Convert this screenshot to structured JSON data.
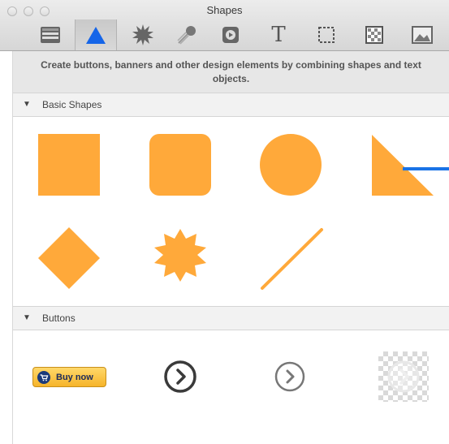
{
  "window": {
    "title": "Shapes"
  },
  "toolbar": {
    "buttons": [
      {
        "icon": "window-icon",
        "selected": false
      },
      {
        "icon": "triangle-shape-icon",
        "selected": true
      },
      {
        "icon": "starburst-icon",
        "selected": false
      },
      {
        "icon": "brush-icon",
        "selected": false
      },
      {
        "icon": "play-media-icon",
        "selected": false
      },
      {
        "icon": "text-icon",
        "selected": false
      },
      {
        "icon": "selection-rect-icon",
        "selected": false
      },
      {
        "icon": "checker-pattern-icon",
        "selected": false
      },
      {
        "icon": "picture-icon",
        "selected": false
      }
    ],
    "text_glyph": "T"
  },
  "description": "Create buttons, banners and other design elements by combining shapes and text objects.",
  "sections": {
    "basic": {
      "label": "Basic Shapes"
    },
    "buttons": {
      "label": "Buttons"
    }
  },
  "buttons_items": {
    "buy_now_label": "Buy now"
  },
  "colors": {
    "shape_fill": "#FFA93A",
    "accent_blue": "#1A73E6",
    "toolbar_selected_icon": "#1565E8"
  }
}
